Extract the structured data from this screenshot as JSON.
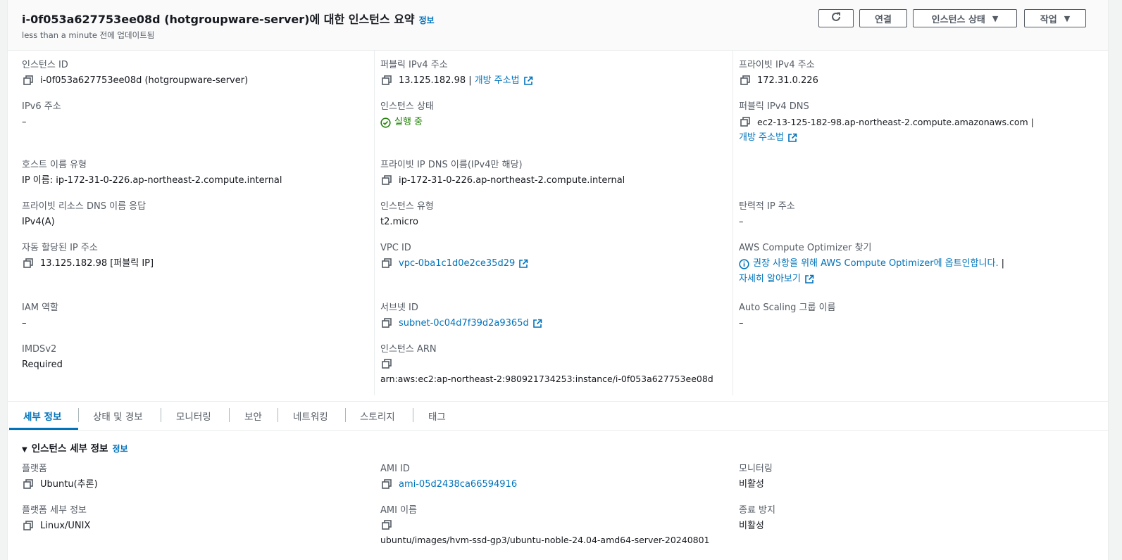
{
  "header": {
    "title": "i-0f053a627753ee08d (hotgroupware-server)에 대한 인스턴스 요약",
    "info_link": "정보",
    "updated": "less than a minute 전에 업데이트됨",
    "buttons": {
      "connect": "연결",
      "instance_state": "인스턴스 상태",
      "actions": "작업"
    }
  },
  "summary": {
    "instance_id": {
      "label": "인스턴스 ID",
      "value": "i-0f053a627753ee08d (hotgroupware-server)"
    },
    "public_ipv4": {
      "label": "퍼블릭 IPv4 주소",
      "value": "13.125.182.98 |",
      "link": "개방 주소법"
    },
    "private_ipv4": {
      "label": "프라이빗 IPv4 주소",
      "value": "172.31.0.226"
    },
    "ipv6": {
      "label": "IPv6 주소",
      "value": "–"
    },
    "instance_state": {
      "label": "인스턴스 상태",
      "value": "실행 중"
    },
    "public_dns": {
      "label": "퍼블릭 IPv4 DNS",
      "value": "ec2-13-125-182-98.ap-northeast-2.compute.amazonaws.com |",
      "link": "개방 주소법"
    },
    "hostname_type": {
      "label": "호스트 이름 유형",
      "value": "IP 이름: ip-172-31-0-226.ap-northeast-2.compute.internal"
    },
    "private_dns": {
      "label": "프라이빗 IP DNS 이름(IPv4만 해당)",
      "value": "ip-172-31-0-226.ap-northeast-2.compute.internal"
    },
    "private_resource_dns": {
      "label": "프라이빗 리소스 DNS 이름 응답",
      "value": "IPv4(A)"
    },
    "instance_type": {
      "label": "인스턴스 유형",
      "value": "t2.micro"
    },
    "elastic_ip": {
      "label": "탄력적 IP 주소",
      "value": "–"
    },
    "auto_ip": {
      "label": "자동 할당된 IP 주소",
      "value": "13.125.182.98 [퍼블릭 IP]"
    },
    "vpc_id": {
      "label": "VPC ID",
      "value": "vpc-0ba1c1d0e2ce35d29"
    },
    "compute_optimizer": {
      "label": "AWS Compute Optimizer 찾기",
      "value": "권장 사항을 위해 AWS Compute Optimizer에 옵트인합니다.",
      "sep": "|",
      "link": "자세히 알아보기"
    },
    "iam_role": {
      "label": "IAM 역할",
      "value": "–"
    },
    "subnet_id": {
      "label": "서브넷 ID",
      "value": "subnet-0c04d7f39d2a9365d"
    },
    "auto_scaling": {
      "label": "Auto Scaling 그룹 이름",
      "value": "–"
    },
    "imdsv2": {
      "label": "IMDSv2",
      "value": "Required"
    },
    "instance_arn": {
      "label": "인스턴스 ARN",
      "value": "arn:aws:ec2:ap-northeast-2:980921734253:instance/i-0f053a627753ee08d"
    }
  },
  "tabs": [
    "세부 정보",
    "상태 및 경보",
    "모니터링",
    "보안",
    "네트워킹",
    "스토리지",
    "태그"
  ],
  "details": {
    "section_title": "인스턴스 세부 정보",
    "info_link": "정보",
    "platform": {
      "label": "플랫폼",
      "value": "Ubuntu(추론)"
    },
    "ami_id": {
      "label": "AMI ID",
      "value": "ami-05d2438ca66594916"
    },
    "monitoring": {
      "label": "모니터링",
      "value": "비활성"
    },
    "platform_details": {
      "label": "플랫폼 세부 정보",
      "value": "Linux/UNIX"
    },
    "ami_name": {
      "label": "AMI 이름",
      "value": "ubuntu/images/hvm-ssd-gp3/ubuntu-noble-24.04-amd64-server-20240801"
    },
    "termination_protection": {
      "label": "종료 방지",
      "value": "비활성"
    }
  },
  "colors": {
    "link": "#0073bb",
    "success": "#1d8102",
    "label": "#545b64",
    "text": "#16191f"
  }
}
